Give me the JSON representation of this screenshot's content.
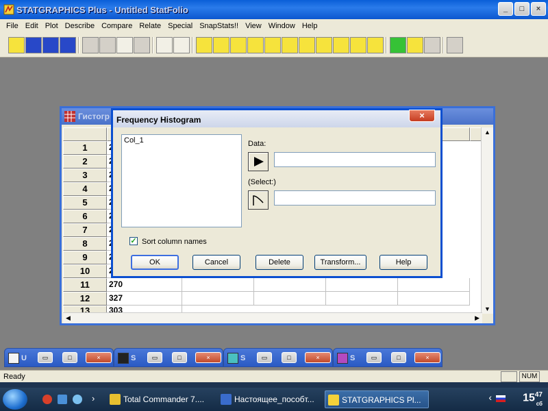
{
  "app": {
    "title": "STATGRAPHICS Plus - Untitled StatFolio",
    "window_buttons": [
      "_",
      "□",
      "×"
    ]
  },
  "menu": [
    "File",
    "Edit",
    "Plot",
    "Describe",
    "Compare",
    "Relate",
    "Special",
    "SnapStats!!",
    "View",
    "Window",
    "Help"
  ],
  "sheet": {
    "title": "Гистогр",
    "rows": [
      "1",
      "2",
      "3",
      "4",
      "5",
      "6",
      "7",
      "8",
      "9",
      "10",
      "11",
      "12",
      "13"
    ],
    "values": [
      "2",
      "2",
      "2",
      "2",
      "2",
      "2",
      "2",
      "2",
      "2",
      "2",
      "270",
      "327",
      "303"
    ]
  },
  "dialog": {
    "title": "Frequency Histogram",
    "close": "×",
    "variables": [
      "Col_1"
    ],
    "data_label": "Data:",
    "data_value": "",
    "select_label": "(Select:)",
    "select_value": "",
    "sort_label": "Sort column names",
    "sort_checked": true,
    "check_mark": "✓",
    "buttons": {
      "ok": "OK",
      "cancel": "Cancel",
      "delete": "Delete",
      "transform": "Transform...",
      "help": "Help"
    }
  },
  "minimized": [
    {
      "label": "U"
    },
    {
      "label": "S"
    },
    {
      "label": "S"
    },
    {
      "label": "S"
    }
  ],
  "status": {
    "ready": "Ready",
    "num": "NUM"
  },
  "taskbar": {
    "tasks": [
      "Total Commander 7....",
      "Настоящее_пособт...",
      "STATGRAPHICS Pl..."
    ],
    "chevron": "›",
    "clock_hour": "15",
    "clock_min": "47",
    "clock_sub": "сб"
  },
  "icons": {
    "play": "play-arrow-icon",
    "select": "select-curve-icon"
  }
}
